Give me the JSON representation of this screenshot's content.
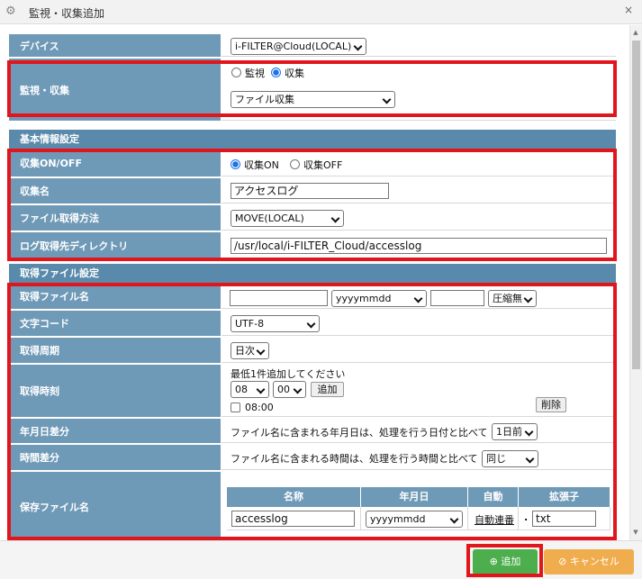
{
  "dialog": {
    "title": "監視・収集追加",
    "gear_icon": "gear-icon",
    "close": "×"
  },
  "device": {
    "label": "デバイス",
    "value": "i-FILTER@Cloud(LOCAL)"
  },
  "monitor": {
    "label": "監視・収集",
    "options": [
      "監視",
      "収集"
    ],
    "selected": "収集",
    "type_value": "ファイル収集"
  },
  "basic_section": {
    "title": "基本情報設定"
  },
  "collect_onoff": {
    "label": "収集ON/OFF",
    "on": "収集ON",
    "off": "収集OFF",
    "selected": "収集ON"
  },
  "collect_name": {
    "label": "収集名",
    "value": "アクセスログ"
  },
  "file_method": {
    "label": "ファイル取得方法",
    "value": "MOVE(LOCAL)"
  },
  "log_dir": {
    "label": "ログ取得先ディレクトリ",
    "value": "/usr/local/i-FILTER_Cloud/accesslog"
  },
  "fetch_section": {
    "title": "取得ファイル設定"
  },
  "fetch_name": {
    "label": "取得ファイル名",
    "prefix": "",
    "date_format": "yyyymmdd",
    "suffix": "",
    "compression": "圧縮無"
  },
  "charset": {
    "label": "文字コード",
    "value": "UTF-8"
  },
  "cycle": {
    "label": "取得周期",
    "value": "日次"
  },
  "fetch_time": {
    "label": "取得時刻",
    "note": "最低1件追加してください",
    "hour": "08",
    "minute": "00",
    "add_button": "追加",
    "entry": "08:00",
    "delete_button": "削除"
  },
  "date_diff": {
    "label": "年月日差分",
    "text": "ファイル名に含まれる年月日は、処理を行う日付と比べて",
    "value": "1日前"
  },
  "time_diff": {
    "label": "時間差分",
    "text": "ファイル名に含まれる時間は、処理を行う時間と比べて",
    "value": "同じ"
  },
  "save_name": {
    "label": "保存ファイル名",
    "headers": [
      "名称",
      "年月日",
      "自動",
      "拡張子"
    ],
    "name_value": "accesslog",
    "date_value": "yyyymmdd",
    "auto_link": "自動連番",
    "dot": ".",
    "ext_value": "txt"
  },
  "footer": {
    "add_label": "追加",
    "cancel_label": "キャンセル"
  },
  "colors": {
    "header_blue": "#6f9ab7",
    "section_blue": "#5a8aab",
    "highlight_red": "#e0161c",
    "add_green": "#4cae4c",
    "cancel_orange": "#f0ad4e"
  }
}
